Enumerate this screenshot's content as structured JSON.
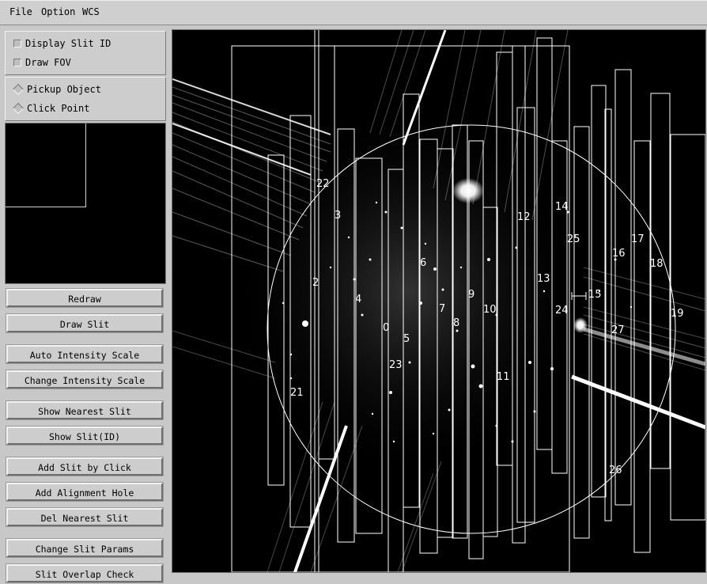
{
  "menu": {
    "file": "File",
    "option": "Option",
    "wcs": "WCS"
  },
  "options": {
    "display_slit_id": "Display Slit ID",
    "draw_fov": "Draw FOV",
    "pickup_object": "Pickup Object",
    "click_point": "Click Point"
  },
  "buttons": {
    "redraw": "Redraw",
    "draw_slit": "Draw Slit",
    "auto_intensity": "Auto Intensity Scale",
    "change_intensity": "Change Intensity Scale",
    "show_nearest": "Show Nearest Slit",
    "show_slit_id": "Show Slit(ID)",
    "add_slit_click": "Add Slit by Click",
    "add_alignment": "Add Alignment Hole",
    "del_nearest": "Del Nearest Slit",
    "change_params": "Change Slit Params",
    "overlap_check": "Slit Overlap Check"
  },
  "slit_labels": [
    "22",
    "3",
    "2",
    "4",
    "6",
    "5",
    "23",
    "21",
    "7",
    "8",
    "9",
    "10",
    "11",
    "12",
    "13",
    "14",
    "24",
    "25",
    "15",
    "16",
    "17",
    "18",
    "19",
    "27",
    "26",
    "0"
  ],
  "colors": {
    "background": "#c8c8c8",
    "image_bg": "#000000",
    "overlay": "#ffffff"
  }
}
